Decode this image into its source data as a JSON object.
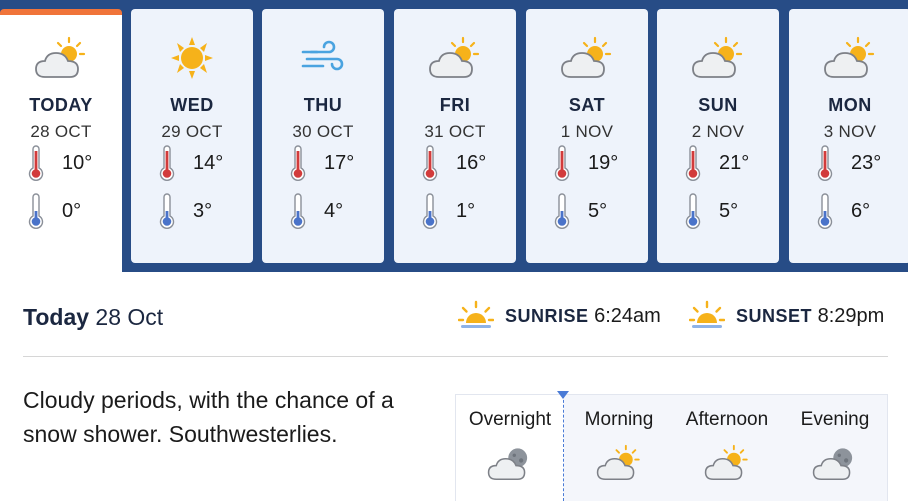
{
  "colors": {
    "band": "#274c86",
    "active_accent": "#f0743a",
    "sun": "#f6b21a",
    "cloud": "#c9ccd1",
    "hot": "#d23b3b",
    "cold": "#4a73c9"
  },
  "days": [
    {
      "name": "TODAY",
      "date": "28 OCT",
      "icon": "partly-cloudy-icon",
      "high": "10°",
      "low": "0°",
      "active": true
    },
    {
      "name": "WED",
      "date": "29 OCT",
      "icon": "sunny-icon",
      "high": "14°",
      "low": "3°",
      "active": false
    },
    {
      "name": "THU",
      "date": "30 OCT",
      "icon": "windy-icon",
      "high": "17°",
      "low": "4°",
      "active": false
    },
    {
      "name": "FRI",
      "date": "31 OCT",
      "icon": "partly-cloudy-icon",
      "high": "16°",
      "low": "1°",
      "active": false
    },
    {
      "name": "SAT",
      "date": "1 NOV",
      "icon": "partly-cloudy-icon",
      "high": "19°",
      "low": "5°",
      "active": false
    },
    {
      "name": "SUN",
      "date": "2 NOV",
      "icon": "partly-cloudy-icon",
      "high": "21°",
      "low": "5°",
      "active": false
    },
    {
      "name": "MON",
      "date": "3 NOV",
      "icon": "partly-cloudy-icon",
      "high": "23°",
      "low": "6°",
      "active": false
    }
  ],
  "summary": {
    "title_bold": "Today",
    "title_date": "28 Oct",
    "sunrise_label": "SUNRISE",
    "sunrise_time": "6:24am",
    "sunset_label": "SUNSET",
    "sunset_time": "8:29pm",
    "description": "Cloudy periods, with the chance of a snow shower. Southwesterlies."
  },
  "periods": [
    {
      "name": "Overnight",
      "icon": "cloudy-night-icon",
      "active": true
    },
    {
      "name": "Morning",
      "icon": "partly-cloudy-icon",
      "active": false
    },
    {
      "name": "Afternoon",
      "icon": "partly-cloudy-icon",
      "active": false
    },
    {
      "name": "Evening",
      "icon": "cloudy-night-icon",
      "active": false
    }
  ]
}
